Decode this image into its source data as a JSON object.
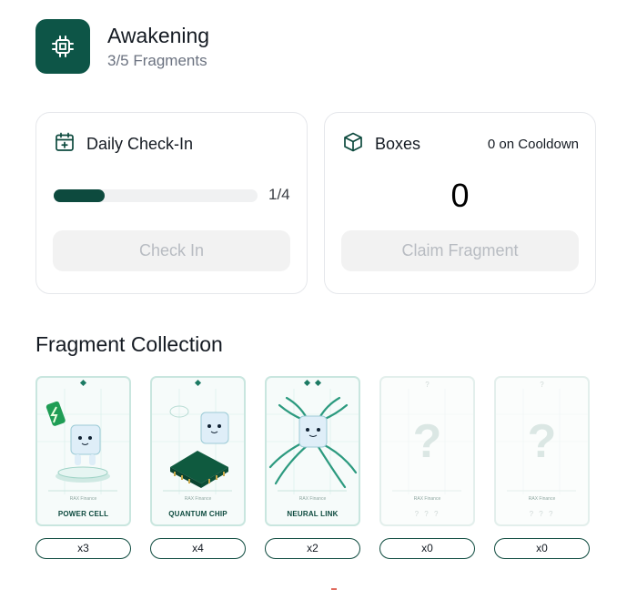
{
  "header": {
    "icon": "cpu-chip-icon",
    "title": "Awakening",
    "subtitle": "3/5 Fragments"
  },
  "checkin": {
    "icon": "calendar-plus-icon",
    "label": "Daily Check-In",
    "progress_text": "1/4",
    "progress_fraction": 0.25,
    "button_label": "Check In"
  },
  "boxes": {
    "icon": "box-icon",
    "label": "Boxes",
    "cooldown_text": "0 on Cooldown",
    "count": "0",
    "button_label": "Claim Fragment"
  },
  "collection": {
    "title": "Fragment Collection",
    "fragments": [
      {
        "name": "POWER CELL",
        "brand": "RAX Finance",
        "count": "x3",
        "unlocked": true
      },
      {
        "name": "QUANTUM CHIP",
        "brand": "RAX Finance",
        "count": "x4",
        "unlocked": true
      },
      {
        "name": "NEURAL LINK",
        "brand": "RAX Finance",
        "count": "x2",
        "unlocked": true
      },
      {
        "name": "? ? ?",
        "brand": "RAX Finance",
        "count": "x0",
        "unlocked": false,
        "top_mark": "?",
        "placeholder": "?"
      },
      {
        "name": "? ? ?",
        "brand": "RAX Finance",
        "count": "x0",
        "unlocked": false,
        "top_mark": "?",
        "placeholder": "?"
      }
    ]
  },
  "colors": {
    "brand": "#0d5547",
    "progress_fill": "#0d4a3e",
    "card_border": "#e5e7eb",
    "disabled_button_bg": "#f2f2f2"
  }
}
